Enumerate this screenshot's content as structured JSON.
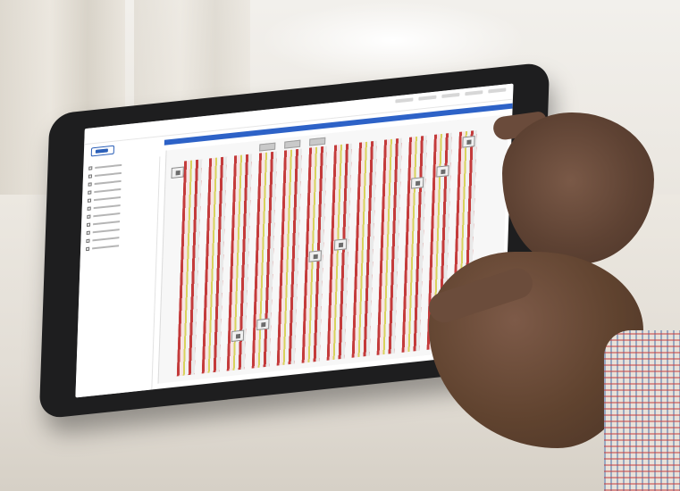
{
  "photo": {
    "subject": "tablet",
    "colors": {
      "bezel": "#1e1e1f",
      "screen": "#ffffff",
      "accent_bar": "#2d62c7",
      "column_red": "#c43b3b",
      "column_yellow": "#d8d35c",
      "skin": "#6b4c3b"
    },
    "icons": [
      "logo-mark",
      "chip-icon"
    ]
  }
}
